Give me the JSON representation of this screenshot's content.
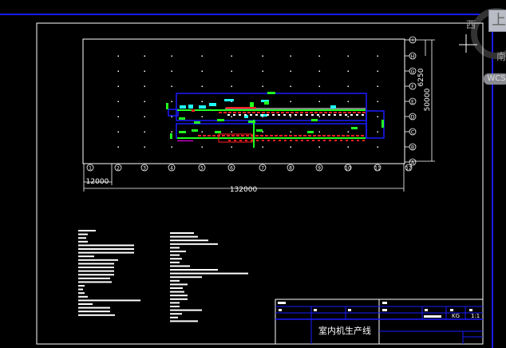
{
  "drawing": {
    "column_labels": [
      "1",
      "2",
      "3",
      "4",
      "5",
      "6",
      "7",
      "8",
      "9",
      "10",
      "11",
      "12"
    ],
    "row_labels": [
      "I",
      "H",
      "G",
      "F",
      "E",
      "D",
      "C",
      "B",
      "A"
    ],
    "dim_total_width": "132000",
    "dim_bay_width": "12000",
    "dim_total_depth": "50000",
    "dim_bay_depth": "6250"
  },
  "title_block": {
    "title": "室内机生产线",
    "scale": "1:1",
    "unit": "KG"
  },
  "viewcube": {
    "top": "上",
    "south": "南",
    "west": "西",
    "wcs": "WCS"
  },
  "colors": {
    "background": "#000000",
    "frame": "#ffffff",
    "layer_blue": "#1a1aff",
    "layer_red": "#ff2020",
    "layer_green": "#20ff20",
    "layer_cyan": "#20ffff"
  }
}
